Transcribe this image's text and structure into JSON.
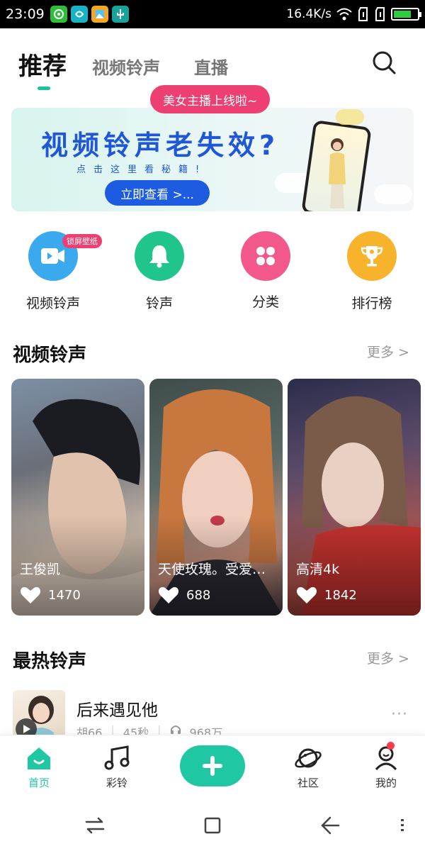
{
  "status_bar": {
    "time": "23:09",
    "network_speed": "16.4K/s",
    "battery_level": 0.75,
    "app_icons": [
      "wechat-icon",
      "app-swirl-icon",
      "gallery-app-icon",
      "usb-icon"
    ]
  },
  "header": {
    "tabs": [
      {
        "label": "推荐",
        "active": true
      },
      {
        "label": "视频铃声",
        "active": false
      },
      {
        "label": "直播",
        "active": false
      }
    ],
    "search_icon": "search-icon"
  },
  "banner": {
    "promo_pill": "美女主播上线啦~",
    "title": "视频铃声老失效?",
    "subtitle": "点击这里看秘籍!",
    "button": "立即查看 >..."
  },
  "categories": [
    {
      "label": "视频铃声",
      "icon": "video-camera-icon",
      "color": "#3aa9ee",
      "badge": "锁屏壁纸"
    },
    {
      "label": "铃声",
      "icon": "bell-icon",
      "color": "#1fc58a"
    },
    {
      "label": "分类",
      "icon": "grid-icon",
      "color": "#f2588a"
    },
    {
      "label": "排行榜",
      "icon": "trophy-icon",
      "color": "#f7b32b"
    }
  ],
  "video_section": {
    "title": "视频铃声",
    "more": "更多 >",
    "cards": [
      {
        "title": "王俊凯",
        "likes": "1470"
      },
      {
        "title": "天使玫瑰。受爱你...",
        "likes": "688"
      },
      {
        "title": "高清4k",
        "likes": "1842"
      }
    ]
  },
  "hot_section": {
    "title": "最热铃声",
    "more": "更多 >",
    "songs": [
      {
        "title": "后来遇见他",
        "artist": "胡66",
        "duration": "45秒",
        "plays": "968万",
        "more": "···"
      }
    ]
  },
  "bottom_nav": {
    "items": [
      {
        "label": "首页",
        "icon": "home-icon",
        "active": true
      },
      {
        "label": "彩铃",
        "icon": "music-note-icon",
        "active": false
      },
      {
        "label": "",
        "icon": "plus-icon",
        "active": false
      },
      {
        "label": "社区",
        "icon": "planet-icon",
        "active": false
      },
      {
        "label": "我的",
        "icon": "person-icon",
        "active": false
      }
    ],
    "accent": "#1fc7a3"
  },
  "system_nav": {
    "buttons": [
      "switch-icon",
      "home-square-icon",
      "back-icon",
      "menu-icon"
    ]
  }
}
